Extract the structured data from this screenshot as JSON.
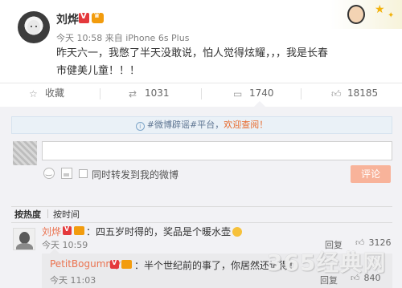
{
  "post": {
    "author": "刘烨",
    "meta": "今天 10:58 来自 iPhone 6s Plus",
    "text": "昨天六一，我憋了半天没敢说，怕人觉得炫耀，，，我是长春市健美儿童！！！"
  },
  "actions": {
    "favorite": "收藏",
    "repost_count": "1031",
    "comment_count": "1740",
    "like_count": "18185"
  },
  "notice": {
    "prefix": "#微博辟谣#平台，",
    "highlight": "欢迎查阅！"
  },
  "composer": {
    "input_value": "",
    "repost_label": "同时转发到我的微博",
    "submit_label": "评论"
  },
  "sort": {
    "hot": "按热度",
    "time": "按时间"
  },
  "comments": [
    {
      "author": "刘烨",
      "text": "：四五岁时得的，奖品是个暖水壶",
      "time": "今天 10:59",
      "reply_label": "回复",
      "like_count": "3126",
      "replies": [
        {
          "author": "PetitBogummy",
          "text": "：半个世纪前的事了，你居然还记得！",
          "time": "今天 11:03",
          "reply_label": "回复",
          "like_count": "840"
        }
      ]
    }
  ],
  "watermark": "365经典网",
  "colors": {
    "accent": "#eb7350",
    "submit_bg": "#f8b39a",
    "panel_bg": "#f2f2f5",
    "notice_bg": "#eaf1f7"
  }
}
